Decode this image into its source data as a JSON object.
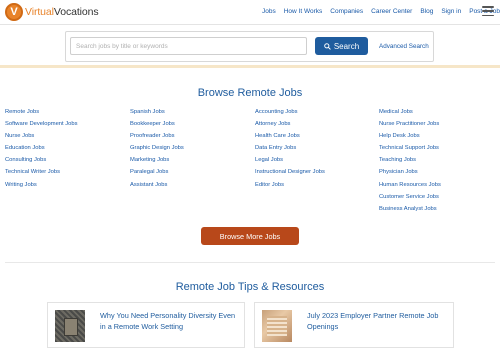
{
  "header": {
    "logo_letter": "V",
    "logo_name_part1": "Virtual",
    "logo_name_part2": "Vocations",
    "nav": [
      "Jobs",
      "How It Works",
      "Companies",
      "Career Center",
      "Blog",
      "Sign in",
      "Post a Job"
    ],
    "menu_icon": "hamburger-menu-icon"
  },
  "search": {
    "placeholder": "Search jobs by title or keywords",
    "button_label": "Search",
    "button_icon": "search-icon",
    "advanced_link": "Advanced Search"
  },
  "browse": {
    "title": "Browse Remote Jobs",
    "columns": [
      [
        "Remote Jobs",
        "Software Development Jobs",
        "Nurse Jobs",
        "Education Jobs",
        "Consulting Jobs",
        "Technical Writer Jobs",
        "Writing Jobs"
      ],
      [
        "Spanish Jobs",
        "Bookkeeper Jobs",
        "Proofreader Jobs",
        "Graphic Design Jobs",
        "Marketing Jobs",
        "Paralegal Jobs",
        "Assistant Jobs"
      ],
      [
        "Accounting Jobs",
        "Attorney Jobs",
        "Health Care Jobs",
        "Data Entry Jobs",
        "Legal Jobs",
        "Instructional Designer Jobs",
        "Editor Jobs"
      ],
      [
        "Medical Jobs",
        "Nurse Practitioner Jobs",
        "Help Desk Jobs",
        "Technical Support Jobs",
        "Teaching Jobs",
        "Physician Jobs",
        "Human Resources Jobs",
        "Customer Service Jobs",
        "Business Analyst Jobs"
      ]
    ],
    "more_button": "Browse More Jobs"
  },
  "tips": {
    "title": "Remote Job Tips & Resources",
    "cards": [
      {
        "title": "Why You Need Personality Diversity Even in a Remote Work Setting"
      },
      {
        "title": "July 2023 Employer Partner Remote Job Openings"
      }
    ]
  },
  "colors": {
    "brand_orange": "#e8832a",
    "link_blue": "#1a5aa8",
    "search_button": "#1f5c9e",
    "more_button": "#b8481a"
  }
}
